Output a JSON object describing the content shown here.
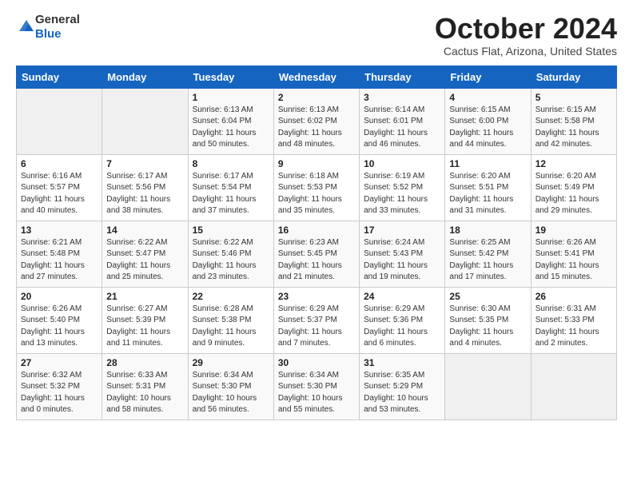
{
  "header": {
    "logo_general": "General",
    "logo_blue": "Blue",
    "month_title": "October 2024",
    "location": "Cactus Flat, Arizona, United States"
  },
  "days_of_week": [
    "Sunday",
    "Monday",
    "Tuesday",
    "Wednesday",
    "Thursday",
    "Friday",
    "Saturday"
  ],
  "weeks": [
    [
      {
        "day": "",
        "sunrise": "",
        "sunset": "",
        "daylight": ""
      },
      {
        "day": "",
        "sunrise": "",
        "sunset": "",
        "daylight": ""
      },
      {
        "day": "1",
        "sunrise": "Sunrise: 6:13 AM",
        "sunset": "Sunset: 6:04 PM",
        "daylight": "Daylight: 11 hours and 50 minutes."
      },
      {
        "day": "2",
        "sunrise": "Sunrise: 6:13 AM",
        "sunset": "Sunset: 6:02 PM",
        "daylight": "Daylight: 11 hours and 48 minutes."
      },
      {
        "day": "3",
        "sunrise": "Sunrise: 6:14 AM",
        "sunset": "Sunset: 6:01 PM",
        "daylight": "Daylight: 11 hours and 46 minutes."
      },
      {
        "day": "4",
        "sunrise": "Sunrise: 6:15 AM",
        "sunset": "Sunset: 6:00 PM",
        "daylight": "Daylight: 11 hours and 44 minutes."
      },
      {
        "day": "5",
        "sunrise": "Sunrise: 6:15 AM",
        "sunset": "Sunset: 5:58 PM",
        "daylight": "Daylight: 11 hours and 42 minutes."
      }
    ],
    [
      {
        "day": "6",
        "sunrise": "Sunrise: 6:16 AM",
        "sunset": "Sunset: 5:57 PM",
        "daylight": "Daylight: 11 hours and 40 minutes."
      },
      {
        "day": "7",
        "sunrise": "Sunrise: 6:17 AM",
        "sunset": "Sunset: 5:56 PM",
        "daylight": "Daylight: 11 hours and 38 minutes."
      },
      {
        "day": "8",
        "sunrise": "Sunrise: 6:17 AM",
        "sunset": "Sunset: 5:54 PM",
        "daylight": "Daylight: 11 hours and 37 minutes."
      },
      {
        "day": "9",
        "sunrise": "Sunrise: 6:18 AM",
        "sunset": "Sunset: 5:53 PM",
        "daylight": "Daylight: 11 hours and 35 minutes."
      },
      {
        "day": "10",
        "sunrise": "Sunrise: 6:19 AM",
        "sunset": "Sunset: 5:52 PM",
        "daylight": "Daylight: 11 hours and 33 minutes."
      },
      {
        "day": "11",
        "sunrise": "Sunrise: 6:20 AM",
        "sunset": "Sunset: 5:51 PM",
        "daylight": "Daylight: 11 hours and 31 minutes."
      },
      {
        "day": "12",
        "sunrise": "Sunrise: 6:20 AM",
        "sunset": "Sunset: 5:49 PM",
        "daylight": "Daylight: 11 hours and 29 minutes."
      }
    ],
    [
      {
        "day": "13",
        "sunrise": "Sunrise: 6:21 AM",
        "sunset": "Sunset: 5:48 PM",
        "daylight": "Daylight: 11 hours and 27 minutes."
      },
      {
        "day": "14",
        "sunrise": "Sunrise: 6:22 AM",
        "sunset": "Sunset: 5:47 PM",
        "daylight": "Daylight: 11 hours and 25 minutes."
      },
      {
        "day": "15",
        "sunrise": "Sunrise: 6:22 AM",
        "sunset": "Sunset: 5:46 PM",
        "daylight": "Daylight: 11 hours and 23 minutes."
      },
      {
        "day": "16",
        "sunrise": "Sunrise: 6:23 AM",
        "sunset": "Sunset: 5:45 PM",
        "daylight": "Daylight: 11 hours and 21 minutes."
      },
      {
        "day": "17",
        "sunrise": "Sunrise: 6:24 AM",
        "sunset": "Sunset: 5:43 PM",
        "daylight": "Daylight: 11 hours and 19 minutes."
      },
      {
        "day": "18",
        "sunrise": "Sunrise: 6:25 AM",
        "sunset": "Sunset: 5:42 PM",
        "daylight": "Daylight: 11 hours and 17 minutes."
      },
      {
        "day": "19",
        "sunrise": "Sunrise: 6:26 AM",
        "sunset": "Sunset: 5:41 PM",
        "daylight": "Daylight: 11 hours and 15 minutes."
      }
    ],
    [
      {
        "day": "20",
        "sunrise": "Sunrise: 6:26 AM",
        "sunset": "Sunset: 5:40 PM",
        "daylight": "Daylight: 11 hours and 13 minutes."
      },
      {
        "day": "21",
        "sunrise": "Sunrise: 6:27 AM",
        "sunset": "Sunset: 5:39 PM",
        "daylight": "Daylight: 11 hours and 11 minutes."
      },
      {
        "day": "22",
        "sunrise": "Sunrise: 6:28 AM",
        "sunset": "Sunset: 5:38 PM",
        "daylight": "Daylight: 11 hours and 9 minutes."
      },
      {
        "day": "23",
        "sunrise": "Sunrise: 6:29 AM",
        "sunset": "Sunset: 5:37 PM",
        "daylight": "Daylight: 11 hours and 7 minutes."
      },
      {
        "day": "24",
        "sunrise": "Sunrise: 6:29 AM",
        "sunset": "Sunset: 5:36 PM",
        "daylight": "Daylight: 11 hours and 6 minutes."
      },
      {
        "day": "25",
        "sunrise": "Sunrise: 6:30 AM",
        "sunset": "Sunset: 5:35 PM",
        "daylight": "Daylight: 11 hours and 4 minutes."
      },
      {
        "day": "26",
        "sunrise": "Sunrise: 6:31 AM",
        "sunset": "Sunset: 5:33 PM",
        "daylight": "Daylight: 11 hours and 2 minutes."
      }
    ],
    [
      {
        "day": "27",
        "sunrise": "Sunrise: 6:32 AM",
        "sunset": "Sunset: 5:32 PM",
        "daylight": "Daylight: 11 hours and 0 minutes."
      },
      {
        "day": "28",
        "sunrise": "Sunrise: 6:33 AM",
        "sunset": "Sunset: 5:31 PM",
        "daylight": "Daylight: 10 hours and 58 minutes."
      },
      {
        "day": "29",
        "sunrise": "Sunrise: 6:34 AM",
        "sunset": "Sunset: 5:30 PM",
        "daylight": "Daylight: 10 hours and 56 minutes."
      },
      {
        "day": "30",
        "sunrise": "Sunrise: 6:34 AM",
        "sunset": "Sunset: 5:30 PM",
        "daylight": "Daylight: 10 hours and 55 minutes."
      },
      {
        "day": "31",
        "sunrise": "Sunrise: 6:35 AM",
        "sunset": "Sunset: 5:29 PM",
        "daylight": "Daylight: 10 hours and 53 minutes."
      },
      {
        "day": "",
        "sunrise": "",
        "sunset": "",
        "daylight": ""
      },
      {
        "day": "",
        "sunrise": "",
        "sunset": "",
        "daylight": ""
      }
    ]
  ]
}
